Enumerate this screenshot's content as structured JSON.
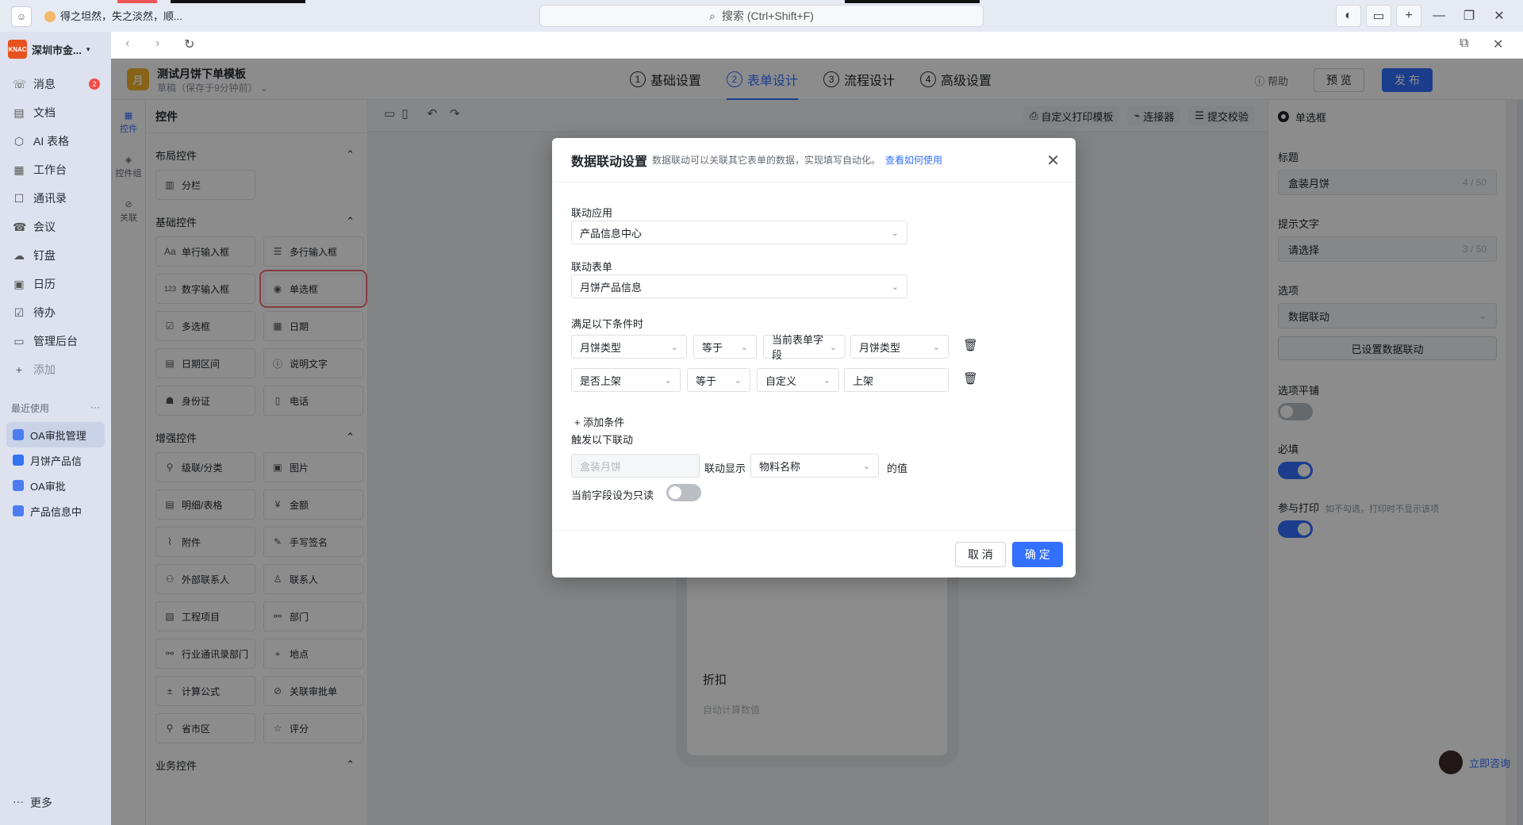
{
  "titlebar": {
    "status_text": "得之坦然，失之淡然，顺...",
    "search_placeholder": "搜索 (Ctrl+Shift+F)"
  },
  "sidebar": {
    "org_name": "深圳市金...",
    "items": [
      {
        "label": "消息",
        "icon": "chat-icon",
        "badge": "2"
      },
      {
        "label": "文档",
        "icon": "doc-icon"
      },
      {
        "label": "AI 表格",
        "icon": "table-icon"
      },
      {
        "label": "工作台",
        "icon": "grid-icon"
      },
      {
        "label": "通讯录",
        "icon": "contacts-icon"
      },
      {
        "label": "会议",
        "icon": "meeting-icon"
      },
      {
        "label": "钉盘",
        "icon": "cloud-icon"
      },
      {
        "label": "日历",
        "icon": "calendar-icon"
      },
      {
        "label": "待办",
        "icon": "todo-icon"
      },
      {
        "label": "管理后台",
        "icon": "monitor-icon"
      },
      {
        "label": "添加",
        "icon": "plus-icon"
      }
    ],
    "recent_title": "最近使用",
    "recent": [
      {
        "label": "OA审批管理"
      },
      {
        "label": "月饼产品信"
      },
      {
        "label": "OA审批"
      },
      {
        "label": "产品信息中"
      }
    ],
    "more_label": "更多"
  },
  "header": {
    "form_icon_char": "月",
    "form_title": "测试月饼下单模板",
    "form_sub": "草稿（保存于9分钟前）",
    "steps": [
      {
        "num": "1",
        "label": "基础设置"
      },
      {
        "num": "2",
        "label": "表单设计"
      },
      {
        "num": "3",
        "label": "流程设计"
      },
      {
        "num": "4",
        "label": "高级设置"
      }
    ],
    "help_label": "帮助",
    "preview_label": "预 览",
    "publish_label": "发 布"
  },
  "vtabs": [
    {
      "label": "控件"
    },
    {
      "label": "控件组"
    },
    {
      "label": "关联"
    }
  ],
  "widgets": {
    "title": "控件",
    "sections": [
      {
        "title": "布局控件",
        "items": [
          {
            "label": "分栏",
            "icon": "▥"
          }
        ]
      },
      {
        "title": "基础控件",
        "items": [
          {
            "label": "单行输入框",
            "icon": "Aa"
          },
          {
            "label": "多行输入框",
            "icon": "☰"
          },
          {
            "label": "数字输入框",
            "icon": "123"
          },
          {
            "label": "单选框",
            "icon": "◉"
          },
          {
            "label": "多选框",
            "icon": "☑"
          },
          {
            "label": "日期",
            "icon": "▦"
          },
          {
            "label": "日期区间",
            "icon": "▤"
          },
          {
            "label": "说明文字",
            "icon": "ⓘ"
          },
          {
            "label": "身份证",
            "icon": "☗"
          },
          {
            "label": "电话",
            "icon": "▯"
          }
        ]
      },
      {
        "title": "增强控件",
        "items": [
          {
            "label": "级联/分类",
            "icon": "⚲"
          },
          {
            "label": "图片",
            "icon": "▣"
          },
          {
            "label": "明细/表格",
            "icon": "▤"
          },
          {
            "label": "金额",
            "icon": "¥"
          },
          {
            "label": "附件",
            "icon": "⌇"
          },
          {
            "label": "手写签名",
            "icon": "✎"
          },
          {
            "label": "外部联系人",
            "icon": "⚇"
          },
          {
            "label": "联系人",
            "icon": "♙"
          },
          {
            "label": "工程项目",
            "icon": "▧"
          },
          {
            "label": "部门",
            "icon": "⚯"
          },
          {
            "label": "行业通讯录部门",
            "icon": "⚯"
          },
          {
            "label": "地点",
            "icon": "⌖"
          },
          {
            "label": "计算公式",
            "icon": "±"
          },
          {
            "label": "关联审批单",
            "icon": "⊘"
          },
          {
            "label": "省市区",
            "icon": "⚲"
          },
          {
            "label": "评分",
            "icon": "☆"
          }
        ]
      },
      {
        "title": "业务控件",
        "items": []
      }
    ]
  },
  "toolbar": {
    "print_label": "自定义打印模板",
    "connector_label": "连接器",
    "submit_check_label": "提交校验"
  },
  "phone": {
    "field_label": "折扣",
    "field_placeholder": "自动计算数值"
  },
  "props": {
    "type_label": "单选框",
    "title_label": "标题",
    "title_value": "盒装月饼",
    "title_count": "4 / 50",
    "hint_label": "提示文字",
    "hint_value": "请选择",
    "hint_count": "3 / 50",
    "options_label": "选项",
    "options_value": "数据联动",
    "linked_btn": "已设置数据联动",
    "tile_label": "选项平铺",
    "tile_on": false,
    "required_label": "必填",
    "required_on": true,
    "print_label": "参与打印",
    "print_note": "如不勾选，打印时不显示该项",
    "print_on": true
  },
  "consult_label": "立即咨询",
  "modal": {
    "title": "数据联动设置",
    "desc": "数据联动可以关联其它表单的数据，实现填写自动化。",
    "link": "查看如何使用",
    "app_label": "联动应用",
    "app_value": "产品信息中心",
    "form_label": "联动表单",
    "form_value": "月饼产品信息",
    "cond_label": "满足以下条件时",
    "conditions": [
      {
        "field": "月饼类型",
        "op": "等于",
        "source": "当前表单字段",
        "value": "月饼类型"
      },
      {
        "field": "是否上架",
        "op": "等于",
        "source": "自定义",
        "value": "上架"
      }
    ],
    "add_cond_label": "添加条件",
    "trigger_label": "触发以下联动",
    "trigger_field": "盒装月饼",
    "trigger_mid": "联动显示",
    "trigger_target": "物料名称",
    "trigger_suffix": "的值",
    "readonly_label": "当前字段设为只读",
    "readonly_on": false,
    "cancel_label": "取 消",
    "ok_label": "确 定"
  }
}
